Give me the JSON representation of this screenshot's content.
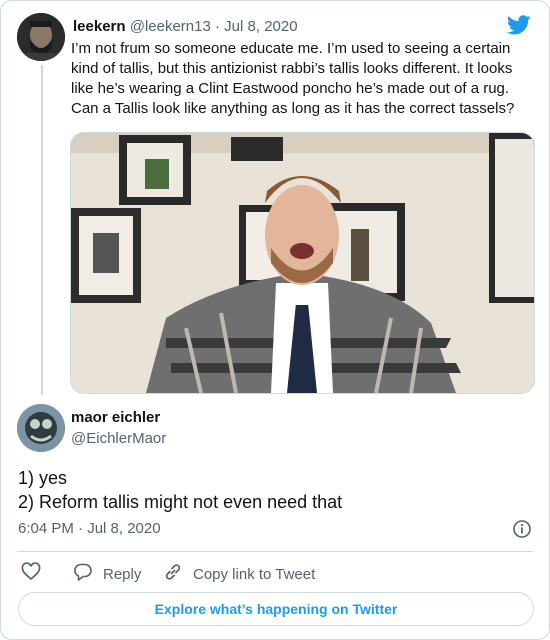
{
  "tweet": {
    "display_name": "leekern",
    "handle": "@leekern13",
    "separator": "·",
    "date": "Jul 8, 2020",
    "text": "I’m not frum so someone educate me. I’m used to seeing a certain kind of tallis, but this antizionist rabbi’s tallis looks different. It looks like he’s wearing a Clint Eastwood poncho he’s made out of a rug. Can a Tallis look like anything as long as it has the correct tassels?",
    "media_description": "video still"
  },
  "reply": {
    "display_name": "maor eichler",
    "handle": "@EichlerMaor",
    "lines": [
      "1) yes",
      "2) Reform tallis might not even need that"
    ],
    "timestamp": "6:04 PM · Jul 8, 2020"
  },
  "actions": {
    "reply_label": "Reply",
    "copy_link_label": "Copy link to Tweet"
  },
  "cta_label": "Explore what’s happening on Twitter",
  "colors": {
    "accent": "#1d9bf0",
    "muted": "#536471",
    "text": "#0f1419",
    "border": "#cfd9de"
  },
  "icons": [
    "twitter-bird-icon",
    "info-icon",
    "heart-icon",
    "reply-bubble-icon",
    "link-icon"
  ]
}
